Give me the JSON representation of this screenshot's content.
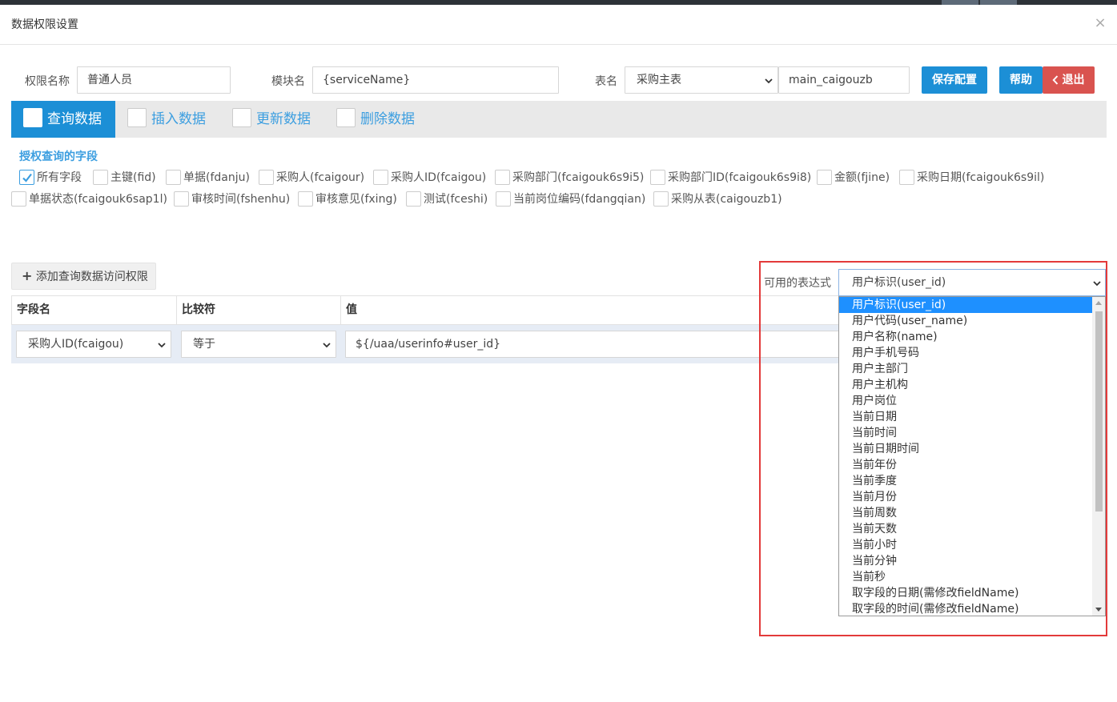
{
  "dialog": {
    "title": "数据权限设置",
    "close_symbol": "×"
  },
  "form": {
    "permission_name_label": "权限名称",
    "permission_name_value": "普通人员",
    "module_label": "模块名",
    "module_value": "{serviceName}",
    "table_label": "表名",
    "table_select_value": "采购主表",
    "table_code_value": "main_caigouzb"
  },
  "buttons": {
    "save": "保存配置",
    "help": "帮助",
    "exit": "退出"
  },
  "tabs": [
    {
      "label": "查询数据",
      "active": true
    },
    {
      "label": "插入数据",
      "active": false
    },
    {
      "label": "更新数据",
      "active": false
    },
    {
      "label": "删除数据",
      "active": false
    }
  ],
  "fields_section": {
    "title": "授权查询的字段",
    "fields": [
      {
        "label": "所有字段",
        "checked": true
      },
      {
        "label": "主键(fid)",
        "checked": false
      },
      {
        "label": "单据(fdanju)",
        "checked": false
      },
      {
        "label": "采购人(fcaigour)",
        "checked": false
      },
      {
        "label": "采购人ID(fcaigou)",
        "checked": false
      },
      {
        "label": "采购部门(fcaigouk6s9i5)",
        "checked": false
      },
      {
        "label": "采购部门ID(fcaigouk6s9i8)",
        "checked": false
      },
      {
        "label": "金额(fjine)",
        "checked": false
      },
      {
        "label": "采购日期(fcaigouk6s9il)",
        "checked": false
      },
      {
        "label": "单据状态(fcaigouk6sap1l)",
        "checked": false
      },
      {
        "label": "审核时间(fshenhu)",
        "checked": false
      },
      {
        "label": "审核意见(fxing)",
        "checked": false
      },
      {
        "label": "测试(fceshi)",
        "checked": false
      },
      {
        "label": "当前岗位编码(fdangqian)",
        "checked": false
      },
      {
        "label": "采购从表(caigouzb1)",
        "checked": false
      }
    ]
  },
  "access": {
    "add_button": "添加查询数据访问权限",
    "add_symbol": "+",
    "columns": [
      "字段名",
      "比较符",
      "值"
    ],
    "row": {
      "field": "采购人ID(fcaigou)",
      "operator": "等于",
      "value": "${/uaa/userinfo#user_id}"
    }
  },
  "expressions": {
    "label": "可用的表达式",
    "selected": "用户标识(user_id)",
    "options": [
      "用户标识(user_id)",
      "用户代码(user_name)",
      "用户名称(name)",
      "用户手机号码",
      "用户主部门",
      "用户主机构",
      "用户岗位",
      "当前日期",
      "当前时间",
      "当前日期时间",
      "当前年份",
      "当前季度",
      "当前月份",
      "当前周数",
      "当前天数",
      "当前小时",
      "当前分钟",
      "当前秒",
      "取字段的日期(需修改fieldName)",
      "取字段的时间(需修改fieldName)"
    ]
  },
  "colors": {
    "primary": "#1c8fd6",
    "danger": "#d9534f",
    "highlight": "#e33a3a",
    "selection": "#1e90ff"
  }
}
